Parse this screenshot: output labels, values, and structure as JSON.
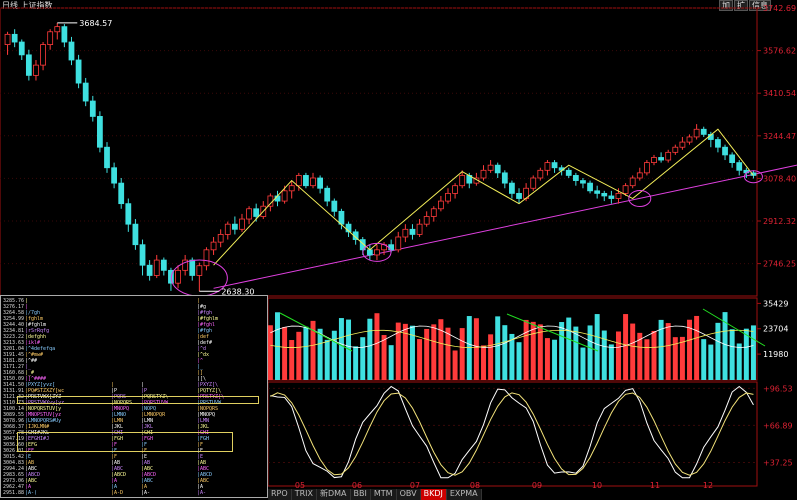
{
  "window": {
    "title": "日线  上证指数"
  },
  "top_buttons": [
    {
      "label": "加"
    },
    {
      "label": "扩"
    },
    {
      "label": "信息"
    }
  ],
  "colors": {
    "up": "#ff3b3b",
    "down": "#3fe0e0",
    "ma_line": "#f4ef5a",
    "trend_line": "#e040e0",
    "axis": "#a01010",
    "volume_label": "#ffffff",
    "kdj_k": "#ffffff",
    "kdj_d": "#f2e27a",
    "green_arrow": "#22dd22"
  },
  "bottom_tabs": [
    {
      "label": "RPO"
    },
    {
      "label": "TRIX"
    },
    {
      "label": "新DMA"
    },
    {
      "label": "BBI"
    },
    {
      "label": "MTM"
    },
    {
      "label": "OBV"
    },
    {
      "label": "BKDJ",
      "active": true
    },
    {
      "label": "EXPMA"
    }
  ],
  "chart_data": [
    {
      "type": "candlestick",
      "title": "上证指数",
      "period": "日线",
      "y_ticks": [
        3742.69,
        3576.62,
        3410.54,
        3244.47,
        3078.4,
        2912.32,
        2746.25
      ],
      "ylim": [
        2620,
        3742.69
      ],
      "annotations": [
        {
          "label": "3684.57",
          "value": 3684.57
        },
        {
          "label": "2638.30",
          "value": 2638.3
        }
      ],
      "x_tick_labels": [
        "05",
        "06",
        "07",
        "08",
        "09",
        "10",
        "11",
        "12"
      ],
      "candles": [
        [
          3600,
          3640,
          3560,
          3650
        ],
        [
          3640,
          3610,
          3590,
          3660
        ],
        [
          3610,
          3560,
          3540,
          3620
        ],
        [
          3560,
          3480,
          3460,
          3580
        ],
        [
          3480,
          3520,
          3460,
          3540
        ],
        [
          3520,
          3600,
          3500,
          3610
        ],
        [
          3600,
          3650,
          3580,
          3660
        ],
        [
          3650,
          3670,
          3620,
          3684.57
        ],
        [
          3670,
          3610,
          3590,
          3680
        ],
        [
          3610,
          3540,
          3520,
          3630
        ],
        [
          3540,
          3450,
          3430,
          3560
        ],
        [
          3450,
          3380,
          3360,
          3470
        ],
        [
          3380,
          3320,
          3300,
          3400
        ],
        [
          3320,
          3200,
          3180,
          3340
        ],
        [
          3200,
          3120,
          3100,
          3220
        ],
        [
          3120,
          3060,
          3040,
          3140
        ],
        [
          3060,
          2980,
          2960,
          3080
        ],
        [
          2980,
          2900,
          2870,
          3000
        ],
        [
          2900,
          2820,
          2800,
          2920
        ],
        [
          2820,
          2740,
          2700,
          2840
        ],
        [
          2740,
          2700,
          2680,
          2760
        ],
        [
          2700,
          2760,
          2690,
          2780
        ],
        [
          2760,
          2720,
          2700,
          2770
        ],
        [
          2720,
          2670,
          2640,
          2730
        ],
        [
          2670,
          2720,
          2650,
          2740
        ],
        [
          2720,
          2760,
          2700,
          2780
        ],
        [
          2760,
          2700,
          2680,
          2770
        ],
        [
          2700,
          2738,
          2638.3,
          2750
        ],
        [
          2738,
          2800,
          2720,
          2810
        ],
        [
          2800,
          2830,
          2780,
          2850
        ],
        [
          2830,
          2860,
          2810,
          2880
        ],
        [
          2860,
          2900,
          2840,
          2910
        ],
        [
          2900,
          2880,
          2860,
          2930
        ],
        [
          2880,
          2920,
          2870,
          2940
        ],
        [
          2920,
          2960,
          2900,
          2970
        ],
        [
          2960,
          2930,
          2910,
          2980
        ],
        [
          2930,
          2970,
          2920,
          2990
        ],
        [
          2970,
          3010,
          2950,
          3020
        ],
        [
          3010,
          2990,
          2970,
          3030
        ],
        [
          2990,
          3030,
          2980,
          3050
        ],
        [
          3030,
          3050,
          3000,
          3070
        ],
        [
          3050,
          3090,
          3030,
          3100
        ],
        [
          3090,
          3050,
          3040,
          3100
        ],
        [
          3050,
          3080,
          3040,
          3100
        ],
        [
          3080,
          3040,
          3020,
          3090
        ],
        [
          3040,
          2990,
          2970,
          3050
        ],
        [
          2990,
          2950,
          2930,
          3000
        ],
        [
          2950,
          2900,
          2880,
          2960
        ],
        [
          2900,
          2870,
          2850,
          2910
        ],
        [
          2870,
          2840,
          2820,
          2880
        ],
        [
          2840,
          2800,
          2780,
          2850
        ],
        [
          2800,
          2780,
          2760,
          2820
        ],
        [
          2780,
          2800,
          2760,
          2820
        ],
        [
          2800,
          2820,
          2780,
          2830
        ],
        [
          2820,
          2800,
          2790,
          2840
        ],
        [
          2800,
          2850,
          2790,
          2870
        ],
        [
          2850,
          2880,
          2830,
          2900
        ],
        [
          2880,
          2860,
          2840,
          2900
        ],
        [
          2860,
          2900,
          2850,
          2920
        ],
        [
          2900,
          2930,
          2890,
          2950
        ],
        [
          2930,
          2960,
          2910,
          2970
        ],
        [
          2960,
          2990,
          2950,
          3010
        ],
        [
          2990,
          3020,
          2980,
          3040
        ],
        [
          3020,
          3050,
          3000,
          3060
        ],
        [
          3050,
          3090,
          3040,
          3110
        ],
        [
          3090,
          3060,
          3040,
          3100
        ],
        [
          3060,
          3080,
          3050,
          3100
        ],
        [
          3080,
          3110,
          3070,
          3130
        ],
        [
          3110,
          3130,
          3100,
          3150
        ],
        [
          3130,
          3100,
          3080,
          3140
        ],
        [
          3100,
          3060,
          3040,
          3110
        ],
        [
          3060,
          3020,
          3000,
          3070
        ],
        [
          3020,
          3000,
          2980,
          3040
        ],
        [
          3000,
          3040,
          2990,
          3060
        ],
        [
          3040,
          3080,
          3030,
          3090
        ],
        [
          3080,
          3110,
          3070,
          3120
        ],
        [
          3110,
          3140,
          3090,
          3150
        ],
        [
          3140,
          3120,
          3100,
          3150
        ],
        [
          3120,
          3110,
          3090,
          3130
        ],
        [
          3110,
          3090,
          3080,
          3120
        ],
        [
          3090,
          3070,
          3050,
          3100
        ],
        [
          3070,
          3060,
          3040,
          3080
        ],
        [
          3060,
          3030,
          3020,
          3070
        ],
        [
          3030,
          3020,
          3000,
          3050
        ],
        [
          3020,
          3010,
          2990,
          3030
        ],
        [
          3010,
          3000,
          2980,
          3030
        ],
        [
          3000,
          3020,
          2980,
          3040
        ],
        [
          3020,
          3050,
          3010,
          3060
        ],
        [
          3050,
          3080,
          3040,
          3090
        ],
        [
          3080,
          3100,
          3070,
          3120
        ],
        [
          3100,
          3140,
          3090,
          3150
        ],
        [
          3140,
          3160,
          3130,
          3170
        ],
        [
          3160,
          3150,
          3140,
          3180
        ],
        [
          3150,
          3180,
          3140,
          3190
        ],
        [
          3180,
          3200,
          3170,
          3210
        ],
        [
          3200,
          3220,
          3190,
          3240
        ],
        [
          3220,
          3240,
          3210,
          3250
        ],
        [
          3240,
          3270,
          3230,
          3290
        ],
        [
          3270,
          3250,
          3240,
          3280
        ],
        [
          3250,
          3230,
          3200,
          3260
        ],
        [
          3230,
          3200,
          3180,
          3240
        ],
        [
          3200,
          3170,
          3150,
          3210
        ],
        [
          3170,
          3140,
          3120,
          3180
        ],
        [
          3140,
          3110,
          3090,
          3150
        ],
        [
          3110,
          3100,
          3080,
          3120
        ],
        [
          3100,
          3090,
          3078,
          3110
        ]
      ],
      "trend_line": {
        "from": {
          "value": 2650,
          "x_index": 29
        },
        "to": {
          "value": 3080,
          "x_index": 105
        }
      }
    },
    {
      "type": "bar",
      "name": "volume",
      "y_ticks": [
        35429,
        23704,
        11980
      ],
      "ylim": [
        0,
        37000
      ]
    },
    {
      "type": "line",
      "name": "BKDJ",
      "y_ticks": [
        96.53,
        66.89,
        37.25
      ],
      "ylim": [
        20,
        100
      ]
    }
  ],
  "overlay": {
    "price_labels": [
      "3285.76",
      "3276.17",
      "3264.58",
      "3254.99",
      "3244.40",
      "3234.81",
      "3223.22",
      "3213.63",
      "3201.04",
      "3191.45",
      "3181.86",
      "3171.27",
      "3160.68",
      "3150.09",
      "3141.50",
      "3131.91",
      "3121.32",
      "3110.73",
      "3100.14",
      "3089.55",
      "3078.96",
      "3068.37",
      "3057.78",
      "3047.19",
      "3036.60",
      "3026.01",
      "3015.42",
      "3004.83",
      "2994.24",
      "2983.65",
      "2973.06",
      "2962.47",
      "2951.88"
    ],
    "columns": [
      {
        "rows": [
          "|",
          "|",
          "|/7gh",
          "|fghlm",
          "|#fghlm",
          "|rSrRqfg",
          "|defghh",
          "|ikl#",
          "|^4defefqa",
          "|^#mw#",
          "|^##",
          "|_",
          "|_#",
          "|]^####",
          "|PXYZ[yvz[",
          "|PQ#STZXZY[wc",
          "|PRSTVWX[ZYZ",
          "|PRSTVWXvy[yz",
          "|NOPQRSTUV[y",
          "|MNOPSTUV[yz",
          "|LMNOPQRS#Uy",
          "|IJKLMN#",
          "|GHI#JKL",
          "|EFGHI#J",
          "|EFG",
          "|EF",
          "|E",
          "|AB",
          "|ABC",
          "|ABCD",
          "|ABC",
          "|A",
          "|A-("
        ]
      },
      {
        "rows": [
          "",
          "",
          "",
          "",
          "",
          "",
          "",
          "",
          "",
          "",
          "",
          "",
          "",
          "",
          "|",
          "|P",
          "|PQRS",
          "|NOPQRS",
          "|MNOPQ",
          "|LMNO",
          "|LMN",
          "|JKL",
          "|GHI",
          "|FGH",
          "|F",
          "|F",
          "|F",
          "|AB",
          "|ABC",
          "|ABCD",
          "|A",
          "|A",
          "|A-D"
        ]
      },
      {
        "rows": [
          "",
          "",
          "",
          "",
          "",
          "",
          "",
          "",
          "",
          "",
          "",
          "",
          "",
          "",
          "|",
          "|P",
          "|PQRSTYZ\\",
          "|PQRSTUVW",
          "|NOPQ",
          "|LMNOPQR",
          "|LMN",
          "|JKL",
          "|GHI",
          "|FGH",
          "|F",
          "|F",
          "|E",
          "|AB",
          "|ABC",
          "|ABCD",
          "|ABC",
          "|A",
          "|A-"
        ]
      },
      {
        "rows": [
          "|",
          "|#g",
          "|#fgh",
          "|#fghlm",
          "|#fghl",
          "|#fgh",
          "|def",
          "|def#",
          "|^d",
          "|^dx",
          "|^",
          "|_",
          "|]",
          "|[\\",
          "|PXYZ[\\",
          "|PQTYZ[\\",
          "|PRSTYZ[\\",
          "|PRSTUVW",
          "|NOPQRS",
          "|MNOPQ",
          "|LMN",
          "|JKL",
          "|GHI",
          "|FGH",
          "|F",
          "|E",
          "|E",
          "|AB",
          "|ABC",
          "|ABCD",
          "|ABC",
          "|A",
          "|A-"
        ]
      }
    ]
  }
}
